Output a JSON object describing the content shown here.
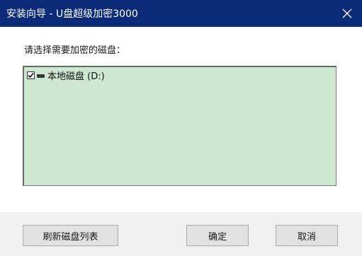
{
  "window": {
    "title": "安装向导 - U盘超级加密3000"
  },
  "prompt": "请选择需要加密的磁盘：",
  "disks": [
    {
      "label": "本地磁盘 (D:)",
      "checked": true
    }
  ],
  "buttons": {
    "refresh": "刷新磁盘列表",
    "ok": "确定",
    "cancel": "取消"
  },
  "colors": {
    "titlebar": "#0b2a78",
    "list_background": "#cde7d1"
  },
  "icons": {
    "close": "close-icon",
    "drive": "drive-icon",
    "checkbox": "checkbox-checked-icon"
  }
}
